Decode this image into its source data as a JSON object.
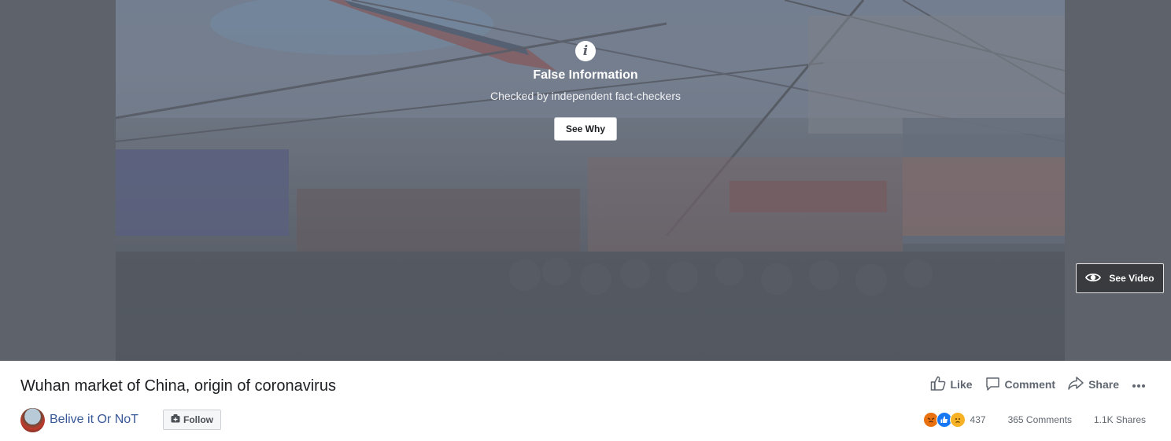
{
  "warning": {
    "title": "False Information",
    "subtitle": "Checked by independent fact-checkers",
    "see_why_label": "See Why"
  },
  "video": {
    "see_video_label": "See Video"
  },
  "post": {
    "title": "Wuhan market of China, origin of coronavirus",
    "page_name": "Belive it Or NoT",
    "follow_label": "Follow"
  },
  "actions": {
    "like_label": "Like",
    "comment_label": "Comment",
    "share_label": "Share"
  },
  "stats": {
    "reaction_count": "437",
    "comments": "365 Comments",
    "shares": "1.1K Shares"
  },
  "colors": {
    "link": "#385898",
    "like_blue": "#1877f2",
    "angry_orange": "#e9710f",
    "sad_yellow": "#f7b125"
  },
  "icons": [
    "info-icon",
    "eye-icon",
    "like-icon",
    "comment-icon",
    "share-icon",
    "more-icon",
    "follow-icon",
    "angry-reaction-icon",
    "like-reaction-icon",
    "sad-reaction-icon"
  ]
}
